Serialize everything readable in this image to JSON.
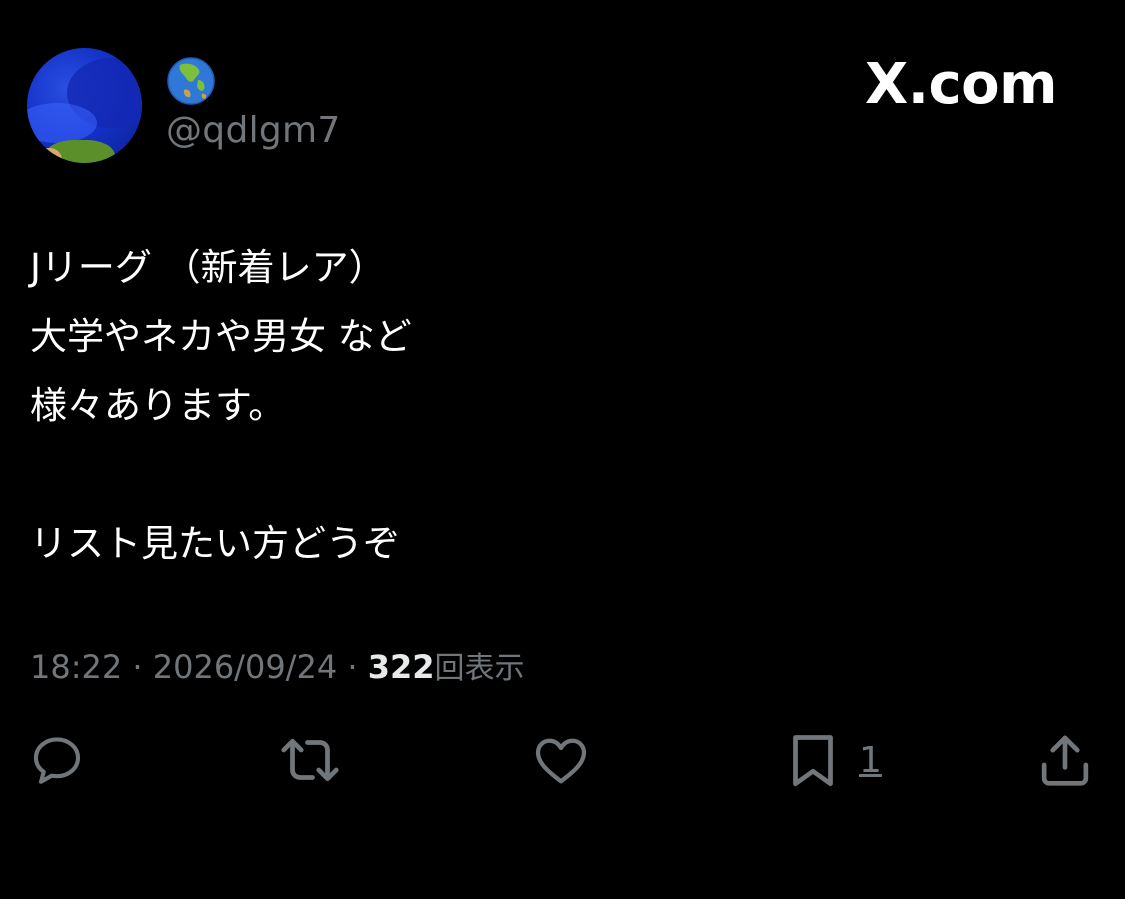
{
  "author": {
    "display_name_emoji": "🌏",
    "handle": "@qdlgm7"
  },
  "brand": {
    "label": "X.com"
  },
  "tweet": {
    "lines": [
      "Jリーグ （新着レア）",
      "大学やネカや男女 など",
      "様々あります。",
      "",
      "リスト見たい方どうぞ"
    ]
  },
  "meta": {
    "time": "18:22",
    "separator1": " · ",
    "date": "2026/09/24",
    "separator2": " · ",
    "views": "322",
    "views_label": "回表示"
  },
  "actions": {
    "reply_icon": "reply-icon",
    "retweet_icon": "retweet-icon",
    "like_icon": "heart-icon",
    "bookmark_icon": "bookmark-icon",
    "bookmark_count": "1",
    "share_icon": "share-icon"
  },
  "colors": {
    "background": "#000000",
    "text": "#ffffff",
    "muted": "#71767b"
  }
}
